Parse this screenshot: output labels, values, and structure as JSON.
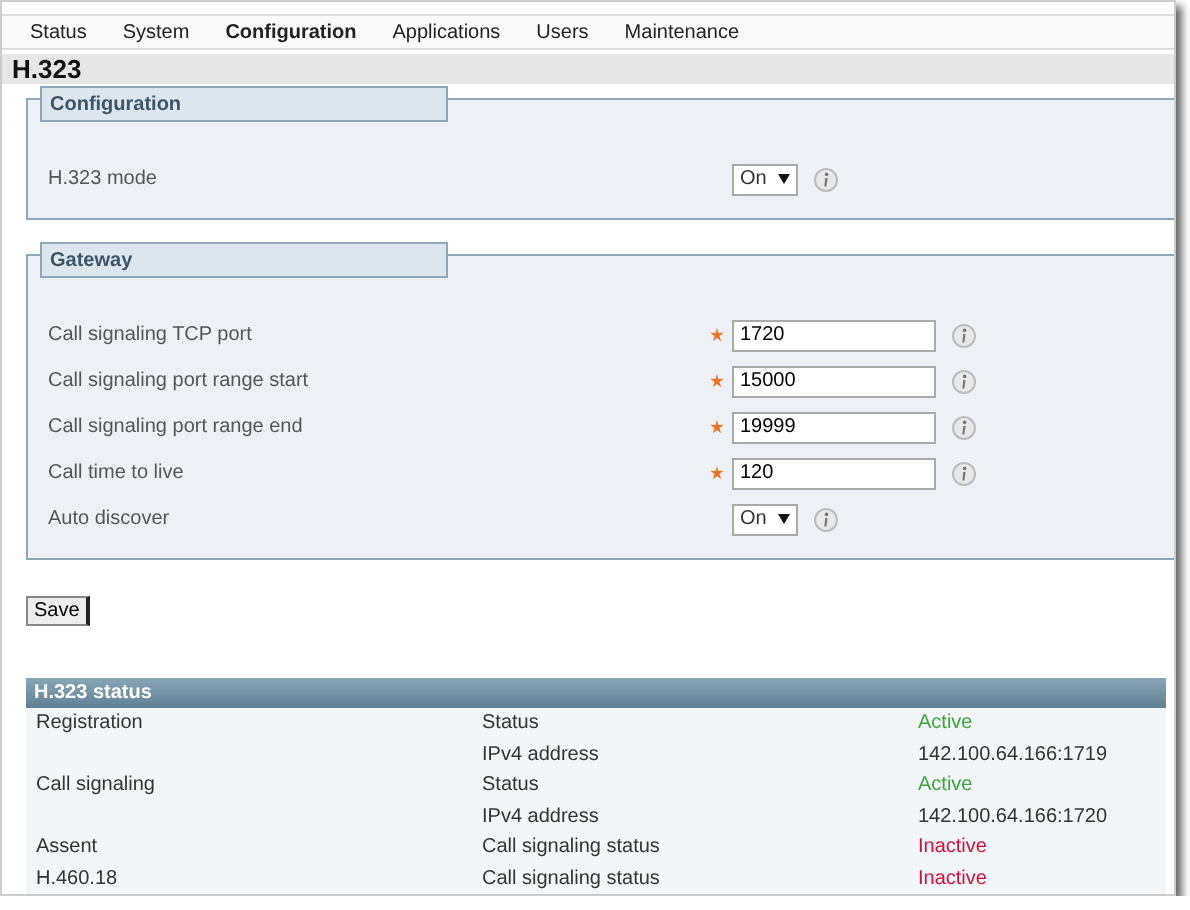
{
  "nav": {
    "items": [
      {
        "label": "Status",
        "selected": false
      },
      {
        "label": "System",
        "selected": false
      },
      {
        "label": "Configuration",
        "selected": true
      },
      {
        "label": "Applications",
        "selected": false
      },
      {
        "label": "Users",
        "selected": false
      },
      {
        "label": "Maintenance",
        "selected": false
      }
    ]
  },
  "page_title": "H.323",
  "sections": [
    {
      "title": "Configuration",
      "fields": [
        {
          "kind": "select",
          "label": "H.323 mode",
          "value": "On",
          "required": false
        }
      ]
    },
    {
      "title": "Gateway",
      "fields": [
        {
          "kind": "text",
          "label": "Call signaling TCP port",
          "value": "1720",
          "required": true
        },
        {
          "kind": "text",
          "label": "Call signaling port range start",
          "value": "15000",
          "required": true
        },
        {
          "kind": "text",
          "label": "Call signaling port range end",
          "value": "19999",
          "required": true
        },
        {
          "kind": "text",
          "label": "Call time to live",
          "value": "120",
          "required": true
        },
        {
          "kind": "select",
          "label": "Auto discover",
          "value": "On",
          "required": false
        }
      ]
    }
  ],
  "save_button": "Save",
  "status": {
    "title": "H.323 status",
    "rows": [
      {
        "name": "Registration",
        "property": "Status",
        "value": "Active",
        "kind": "active"
      },
      {
        "name": "",
        "property": "IPv4 address",
        "value": "142.100.64.166:1719",
        "kind": "plain"
      },
      {
        "name": "Call signaling",
        "property": "Status",
        "value": "Active",
        "kind": "active"
      },
      {
        "name": "",
        "property": "IPv4 address",
        "value": "142.100.64.166:1720",
        "kind": "plain"
      },
      {
        "name": "Assent",
        "property": "Call signaling status",
        "value": "Inactive",
        "kind": "inactive"
      },
      {
        "name": "H.460.18",
        "property": "Call signaling status",
        "value": "Inactive",
        "kind": "inactive"
      }
    ]
  }
}
